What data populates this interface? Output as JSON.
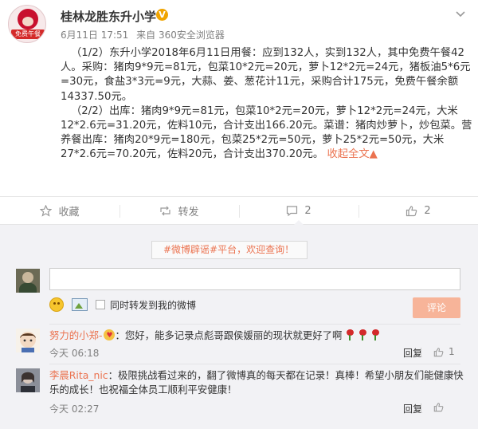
{
  "post": {
    "author": "桂林龙胜东升小学",
    "avatar_badge": "免费午餐",
    "time": "6月11日 17:51",
    "source": "来自 360安全浏览器",
    "para1": "（1/2）东升小学2018年6月11日用餐：应到132人，实到132人，其中免费午餐42人。采购：猪肉9*9元=81元，包菜10*2元=20元，萝卜12*2元=24元，猪板油5*6元=30元，食盐3*3元=9元，大蒜、姜、葱花计11元，采购合计175元，免费午餐余额14337.50元。",
    "para2": "（2/2）出库：猪肉9*9元=81元，包菜10*2元=20元，萝卜12*2元=24元，大米12*2.6元=31.20元，佐料10元，合计支出166.20元。菜谱：猪肉炒萝卜，炒包菜。营养餐出库：猪肉20*9元=180元，包菜25*2元=50元，萝卜25*2元=50元，大米27*2.6元=70.20元，佐料20元，合计支出370.20元。",
    "collapse_label": "收起全文",
    "collapse_arrow": "▲"
  },
  "actions": {
    "favorite": "收藏",
    "repost": "转发",
    "comment_count": "2",
    "like_count": "2"
  },
  "comment_box": {
    "tag_hash": "#微博辟谣#平台，",
    "tag_link": "欢迎查询！",
    "input_value": "",
    "repost_checkbox_label": "同时转发到我的微博",
    "submit_label": "评论"
  },
  "comments": [
    {
      "user": "努力的小郑-",
      "text": "：您好，能多记录点彪哥跟侯媛丽的现状就更好了啊",
      "time": "今天 06:18",
      "reply": "回复",
      "likes": "1"
    },
    {
      "user": "李晨Rita_nic",
      "text": "：极限挑战看过来的，翻了微博真的每天都在记录！真棒！希望小朋友们能健康快乐的成长！也祝福全体员工顺利平安健康！",
      "time": "今天 02:27",
      "reply": "回复",
      "likes": ""
    }
  ],
  "colors": {
    "accent": "#eb7350",
    "verified": "#f0a400",
    "comment_bg": "#f2f2f5"
  }
}
